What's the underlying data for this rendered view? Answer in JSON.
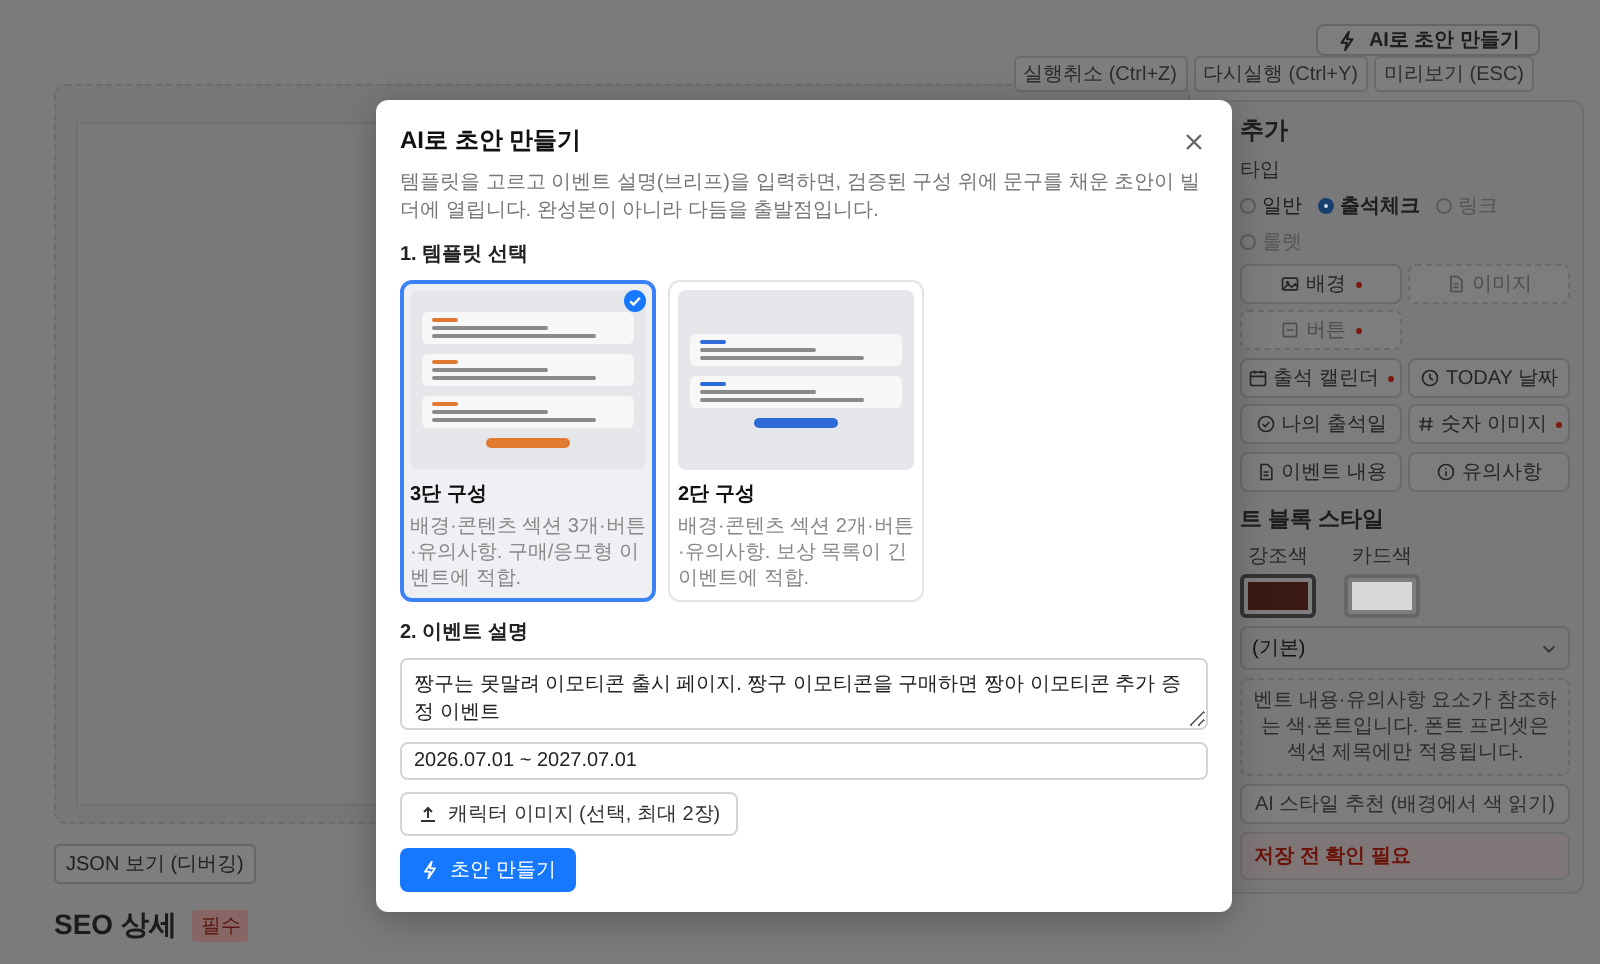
{
  "header_button": {
    "label": "AI로 초안 만들기"
  },
  "toolbar": [
    {
      "label": "실행취소 (Ctrl+Z)"
    },
    {
      "label": "다시실행 (Ctrl+Y)"
    },
    {
      "label": "미리보기 (ESC)"
    }
  ],
  "panel": {
    "title": "추가",
    "type_label": "타입",
    "types": [
      {
        "label": "일반",
        "selected": false,
        "disabled": false
      },
      {
        "label": "출석체크",
        "selected": true,
        "disabled": false
      },
      {
        "label": "링크",
        "selected": false,
        "disabled": true
      },
      {
        "label": "룰렛",
        "selected": false,
        "disabled": true
      }
    ],
    "element_groups": [
      [
        {
          "label": "배경",
          "kind": "image",
          "required": true,
          "disabled": false
        },
        {
          "label": "이미지",
          "kind": "file",
          "required": false,
          "disabled": true
        },
        {
          "label": "버튼",
          "kind": "square",
          "required": true,
          "disabled": true
        }
      ],
      [
        {
          "label": "출석 캘린더",
          "kind": "calendar",
          "required": true,
          "disabled": false
        },
        {
          "label": "TODAY 날짜",
          "kind": "clock",
          "required": false,
          "disabled": false
        },
        {
          "label": "나의 출석일",
          "kind": "check",
          "required": false,
          "disabled": false
        },
        {
          "label": "숫자 이미지",
          "kind": "hash",
          "required": true,
          "disabled": false
        }
      ],
      [
        {
          "label": "이벤트 내용",
          "kind": "file",
          "required": false,
          "disabled": false
        },
        {
          "label": "유의사항",
          "kind": "info",
          "required": false,
          "disabled": false
        }
      ]
    ],
    "style_title": "트 블록 스타일",
    "swatches": [
      {
        "label": "강조색",
        "color": "#3a1a12",
        "selected": true
      },
      {
        "label": "카드색",
        "color": "#d8d8d8",
        "selected": false
      }
    ],
    "font_select": {
      "value": "(기본)"
    },
    "note": "벤트 내용·유의사항 요소가 참조하는 색·폰트입니다. 폰트 프리셋은 섹션 제목에만 적용됩니다.",
    "ai_style_button": {
      "label": "AI 스타일 추천 (배경에서 색 읽기)"
    },
    "warning": "저장 전 확인 필요"
  },
  "json_button": {
    "label": "JSON 보기 (디버깅)"
  },
  "seo": {
    "title": "SEO 상세",
    "badge": "필수"
  },
  "modal": {
    "title": "AI로 초안 만들기",
    "description": "템플릿을 고르고 이벤트 설명(브리프)을 입력하면, 검증된 구성 위에 문구를 채운 초안이 빌더에 열립니다. 완성본이 아니라 다듬을 출발점입니다.",
    "section_1": "1. 템플릿 선택",
    "templates": [
      {
        "kind": "three-section",
        "title": "3단 구성",
        "description": "배경·콘텐츠 섹션 3개·버튼·유의사항. 구매/응모형 이벤트에 적합.",
        "color": "#e07a30",
        "selected": true
      },
      {
        "kind": "two-section",
        "title": "2단 구성",
        "description": "배경·콘텐츠 섹션 2개·버튼·유의사항. 보상 목록이 긴 이벤트에 적합.",
        "color": "#2f6bd8",
        "selected": false
      }
    ],
    "section_2": "2. 이벤트 설명",
    "brief": {
      "value": "짱구는 못말려 이모티콘 출시 페이지. 짱구 이모티콘을 구매하면 짱아 이모티콘 추가 증정 이벤트"
    },
    "period": {
      "value": "2026.07.01 ~ 2027.07.01"
    },
    "upload_button": {
      "label": "캐릭터 이미지 (선택, 최대 2장)"
    },
    "submit_button": {
      "label": "초안 만들기"
    }
  }
}
